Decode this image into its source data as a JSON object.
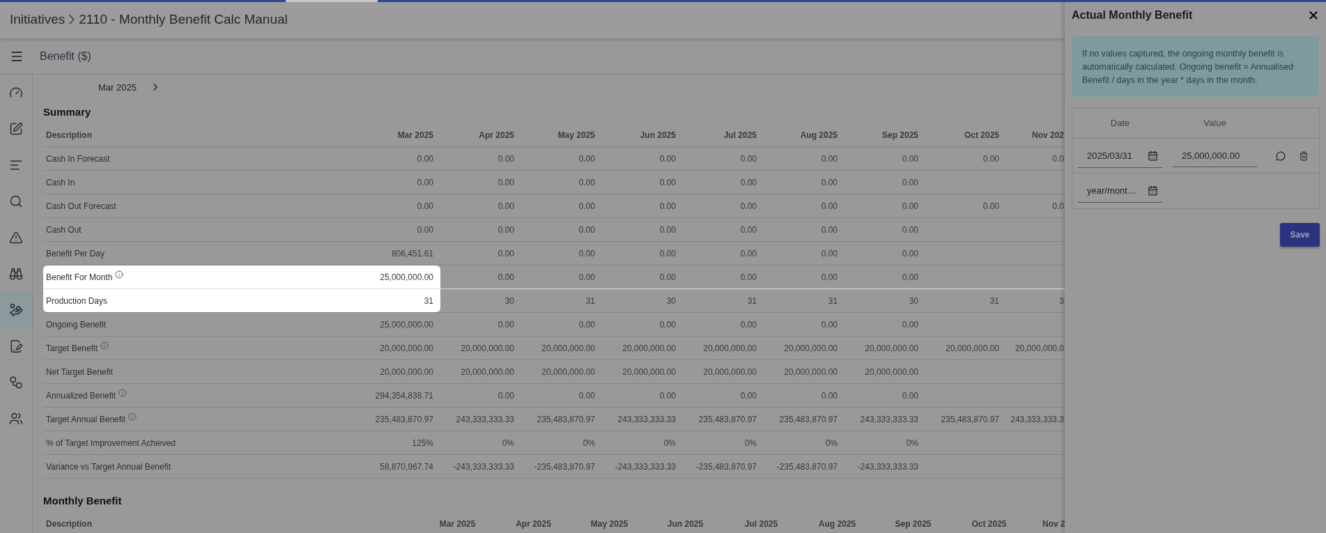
{
  "breadcrumb": {
    "parent": "Initiatives",
    "title": "2110 - Monthly Benefit Calc Manual"
  },
  "section_bar": {
    "title": "Benefit ($)"
  },
  "sidebar": {
    "items": [
      {
        "kind": "gauge",
        "selected": false
      },
      {
        "kind": "edit",
        "selected": false
      },
      {
        "kind": "lines",
        "selected": false
      },
      {
        "kind": "search",
        "selected": false
      },
      {
        "kind": "warning",
        "selected": false
      },
      {
        "kind": "binoculars",
        "selected": false
      },
      {
        "kind": "hand",
        "selected": true
      },
      {
        "kind": "file",
        "selected": false
      },
      {
        "kind": "workflow",
        "selected": false
      },
      {
        "kind": "people",
        "selected": false
      }
    ]
  },
  "month_picker": {
    "label": "Mar 2025"
  },
  "summary": {
    "title": "Summary",
    "columns": [
      "Description",
      "Mar 2025",
      "Apr 2025",
      "May 2025",
      "Jun 2025",
      "Jul 2025",
      "Aug 2025",
      "Sep 2025",
      "Oct 2025",
      "Nov 202"
    ],
    "rows": [
      {
        "label": "Cash In Forecast",
        "info": false,
        "spotlight": false,
        "values": [
          "0.00",
          "0.00",
          "0.00",
          "0.00",
          "0.00",
          "0.00",
          "0.00",
          "0.00",
          "0.0"
        ]
      },
      {
        "label": "Cash In",
        "info": false,
        "spotlight": false,
        "values": [
          "0.00",
          "0.00",
          "0.00",
          "0.00",
          "0.00",
          "0.00",
          "0.00"
        ]
      },
      {
        "label": "Cash Out Forecast",
        "info": false,
        "spotlight": false,
        "values": [
          "0.00",
          "0.00",
          "0.00",
          "0.00",
          "0.00",
          "0.00",
          "0.00",
          "0.00",
          "0.0"
        ]
      },
      {
        "label": "Cash Out",
        "info": false,
        "spotlight": false,
        "values": [
          "0.00",
          "0.00",
          "0.00",
          "0.00",
          "0.00",
          "0.00",
          "0.00"
        ]
      },
      {
        "label": "Benefit Per Day",
        "info": false,
        "spotlight": false,
        "values": [
          "806,451.61",
          "0.00",
          "0.00",
          "0.00",
          "0.00",
          "0.00",
          "0.00"
        ]
      },
      {
        "label": "Benefit For Month",
        "info": true,
        "spotlight": true,
        "values": [
          "25,000,000.00",
          "0.00",
          "0.00",
          "0.00",
          "0.00",
          "0.00",
          "0.00"
        ]
      },
      {
        "label": "Production Days",
        "info": false,
        "spotlight": true,
        "values": [
          "31",
          "30",
          "31",
          "30",
          "31",
          "31",
          "30",
          "31",
          "3"
        ]
      },
      {
        "label": "Ongoing Benefit",
        "info": false,
        "spotlight": false,
        "values": [
          "25,000,000.00",
          "0.00",
          "0.00",
          "0.00",
          "0.00",
          "0.00",
          "0.00"
        ]
      },
      {
        "label": "Target Benefit",
        "info": true,
        "spotlight": false,
        "values": [
          "20,000,000.00",
          "20,000,000.00",
          "20,000,000.00",
          "20,000,000.00",
          "20,000,000.00",
          "20,000,000.00",
          "20,000,000.00",
          "20,000,000.00",
          "20,000,000.0"
        ]
      },
      {
        "label": "Net Target Benefit",
        "info": false,
        "spotlight": false,
        "values": [
          "20,000,000.00",
          "20,000,000.00",
          "20,000,000.00",
          "20,000,000.00",
          "20,000,000.00",
          "20,000,000.00",
          "20,000,000.00"
        ]
      },
      {
        "label": "Annualized Benefit",
        "info": true,
        "spotlight": false,
        "values": [
          "294,354,838.71",
          "0.00",
          "0.00",
          "0.00",
          "0.00",
          "0.00",
          "0.00"
        ]
      },
      {
        "label": "Target Annual Benefit",
        "info": true,
        "spotlight": false,
        "values": [
          "235,483,870.97",
          "243,333,333.33",
          "235,483,870.97",
          "243,333,333.33",
          "235,483,870.97",
          "235,483,870.97",
          "243,333,333.33",
          "235,483,870.97",
          "243,333,333.3"
        ]
      },
      {
        "label": "% of Target Improvement Achieved",
        "info": false,
        "spotlight": false,
        "values": [
          "125%",
          "0%",
          "0%",
          "0%",
          "0%",
          "0%",
          "0%"
        ]
      },
      {
        "label": "Variance vs Target Annual Benefit",
        "info": false,
        "spotlight": false,
        "values": [
          "58,870,967.74",
          "-243,333,333.33",
          "-235,483,870.97",
          "-243,333,333.33",
          "-235,483,870.97",
          "-235,483,870.97",
          "-243,333,333.33"
        ]
      }
    ]
  },
  "monthly_benefit": {
    "title": "Monthly Benefit",
    "columns": [
      "Description",
      "Mar 2025",
      "Apr 2025",
      "May 2025",
      "Jun 2025",
      "Jul 2025",
      "Aug 2025",
      "Sep 2025",
      "Oct 2025",
      "Nov 2"
    ]
  },
  "panel": {
    "title": "Actual Monthly Benefit",
    "note": "If no values captured, the ongoing monthly benefit is automatically calculated. Ongoing benefit = Annualised Benefit / days in the year * days in the month.",
    "columns": [
      "Date",
      "Value"
    ],
    "rows": [
      {
        "date": "2025/03/31",
        "value": "25,000,000.00"
      },
      {
        "date_placeholder": "year/mont…"
      }
    ],
    "save": "Save"
  }
}
